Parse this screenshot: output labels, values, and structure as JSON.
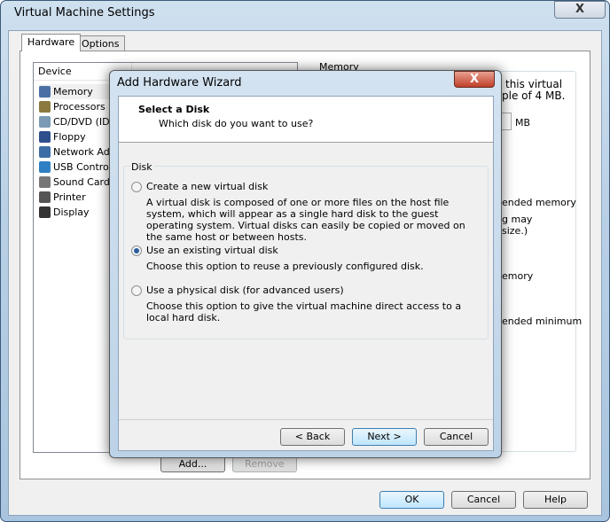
{
  "window": {
    "title": "Virtual Machine Settings",
    "close": "X"
  },
  "tabs": [
    {
      "label": "Hardware",
      "active": true
    },
    {
      "label": "Options",
      "active": false
    }
  ],
  "device_list": {
    "header": "Device",
    "items": [
      {
        "label": "Memory",
        "icon": "memory-icon",
        "color": "#4a6fa5"
      },
      {
        "label": "Processors",
        "icon": "processor-icon",
        "color": "#8a7a40"
      },
      {
        "label": "CD/DVD (IDE)",
        "icon": "cd-icon",
        "color": "#7a9ab5"
      },
      {
        "label": "Floppy",
        "icon": "floppy-icon",
        "color": "#2e4e8c"
      },
      {
        "label": "Network Adapter",
        "icon": "network-icon",
        "color": "#3b6ea5"
      },
      {
        "label": "USB Controller",
        "icon": "usb-icon",
        "color": "#2f7fc4"
      },
      {
        "label": "Sound Card",
        "icon": "speaker-icon",
        "color": "#777"
      },
      {
        "label": "Printer",
        "icon": "printer-icon",
        "color": "#555"
      },
      {
        "label": "Display",
        "icon": "display-icon",
        "color": "#333"
      }
    ]
  },
  "memory": {
    "group": "Memory",
    "line1": "this virtual",
    "line2": "ple of 4 MB.",
    "unit": "MB",
    "t1": "ended memory",
    "t2": "g may",
    "t3": " size.)",
    "t4": "emory",
    "t5": "ended minimum"
  },
  "buttons": {
    "add": "Add...",
    "remove": "Remove",
    "ok": "OK",
    "cancel": "Cancel",
    "help": "Help"
  },
  "wizard": {
    "title": "Add Hardware Wizard",
    "close": "X",
    "heading": "Select a Disk",
    "subheading": "Which disk do you want to use?",
    "group": "Disk",
    "options": [
      {
        "label": "Create a new virtual disk",
        "selected": false,
        "desc": "A virtual disk is composed of one or more files on the host file system, which will appear as a single hard disk to the guest operating system. Virtual disks can easily be copied or moved on the same host or between hosts."
      },
      {
        "label": "Use an existing virtual disk",
        "selected": true,
        "desc": "Choose this option to reuse a previously configured disk."
      },
      {
        "label": "Use a physical disk (for advanced users)",
        "selected": false,
        "desc": "Choose this option to give the virtual machine direct access to a local hard disk."
      }
    ],
    "back": "< Back",
    "next": "Next >",
    "cancel": "Cancel"
  }
}
